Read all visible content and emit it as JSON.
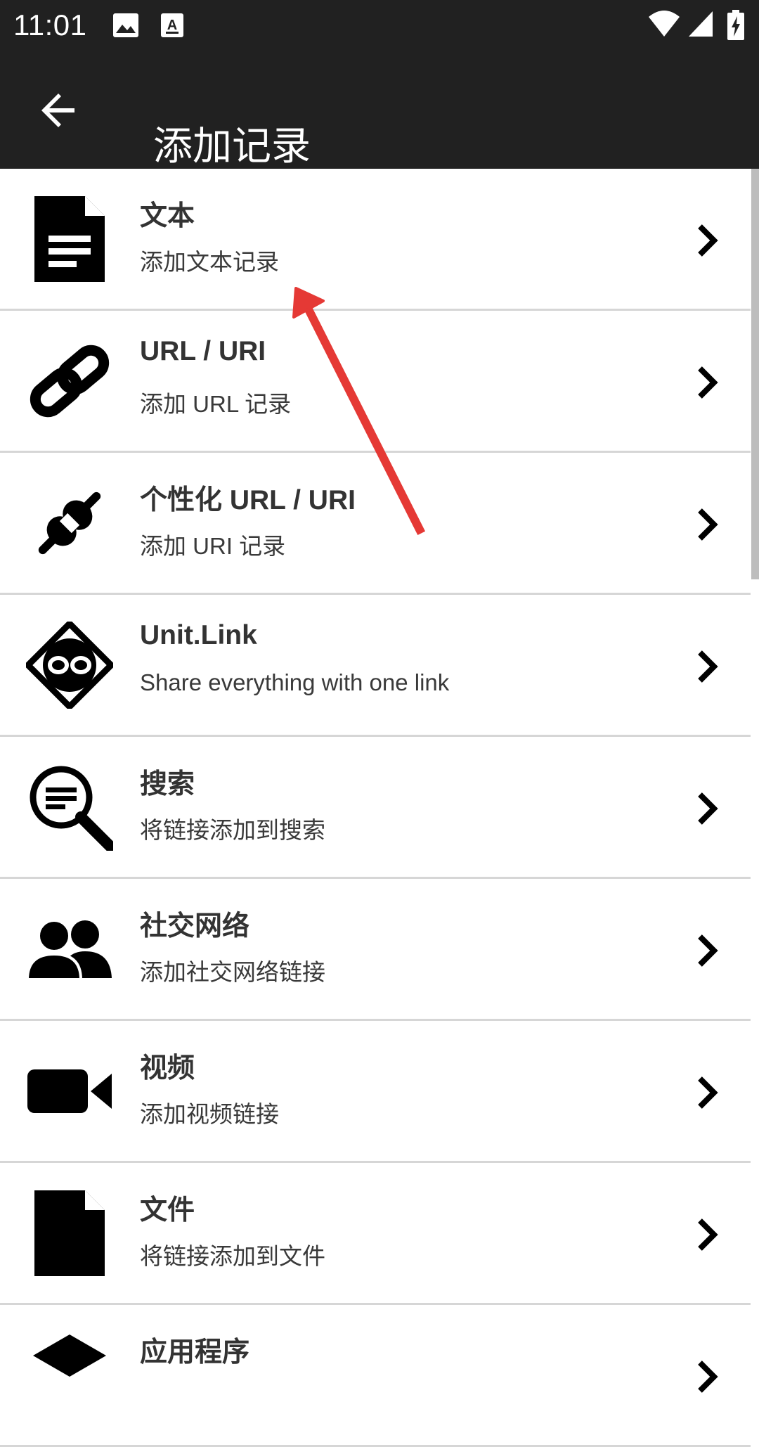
{
  "status_bar": {
    "time": "11:01",
    "left_icons": [
      "image-icon",
      "keyboard-a-icon"
    ],
    "right_icons": [
      "wifi-icon",
      "cellular-signal-icon",
      "battery-charging-icon"
    ]
  },
  "app_bar": {
    "back_icon": "arrow-back-icon",
    "title": "添加记录"
  },
  "items": [
    {
      "icon": "document-icon",
      "title": "文本",
      "subtitle": "添加文本记录"
    },
    {
      "icon": "link-icon",
      "title": "URL / URI",
      "subtitle": "添加 URL 记录"
    },
    {
      "icon": "custom-link-icon",
      "title": "个性化 URL / URI",
      "subtitle": "添加 URI 记录"
    },
    {
      "icon": "unitlink-logo-icon",
      "title": "Unit.Link",
      "subtitle": "Share everything with one link"
    },
    {
      "icon": "search-icon",
      "title": "搜索",
      "subtitle": "将链接添加到搜索"
    },
    {
      "icon": "people-icon",
      "title": "社交网络",
      "subtitle": "添加社交网络链接"
    },
    {
      "icon": "video-camera-icon",
      "title": "视频",
      "subtitle": "添加视频链接"
    },
    {
      "icon": "file-icon",
      "title": "文件",
      "subtitle": "将链接添加到文件"
    },
    {
      "icon": "app-icon",
      "title": "应用程序",
      "subtitle": ""
    }
  ],
  "colors": {
    "bar_background": "#212121",
    "list_background": "#ffffff",
    "divider": "#d6d6d6",
    "annotation_arrow": "#e53935"
  }
}
